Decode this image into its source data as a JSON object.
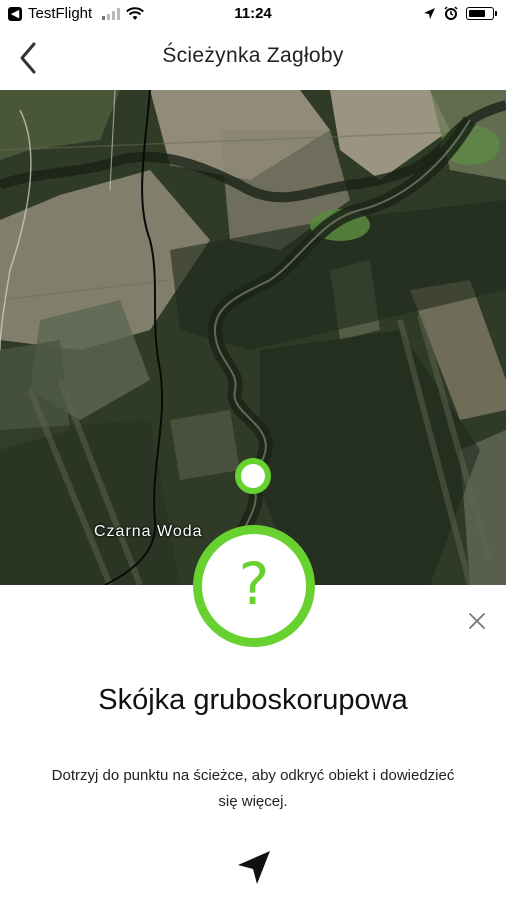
{
  "status_bar": {
    "carrier": "TestFlight",
    "time": "11:24"
  },
  "header": {
    "title": "Ścieżynka Zagłoby"
  },
  "map": {
    "place_label": "Czarna Woda"
  },
  "detail": {
    "title": "Skójka gruboskorupowa",
    "description": "Dotrzyj do punktu na ścieżce, aby odkryć obiekt i dowiedzieć się więcej.",
    "symbol": "?"
  },
  "colors": {
    "accent_green": "#66d12f"
  },
  "icons": {
    "back": "chevron-left-icon",
    "close": "close-icon",
    "navigate": "navigation-arrow-icon"
  }
}
